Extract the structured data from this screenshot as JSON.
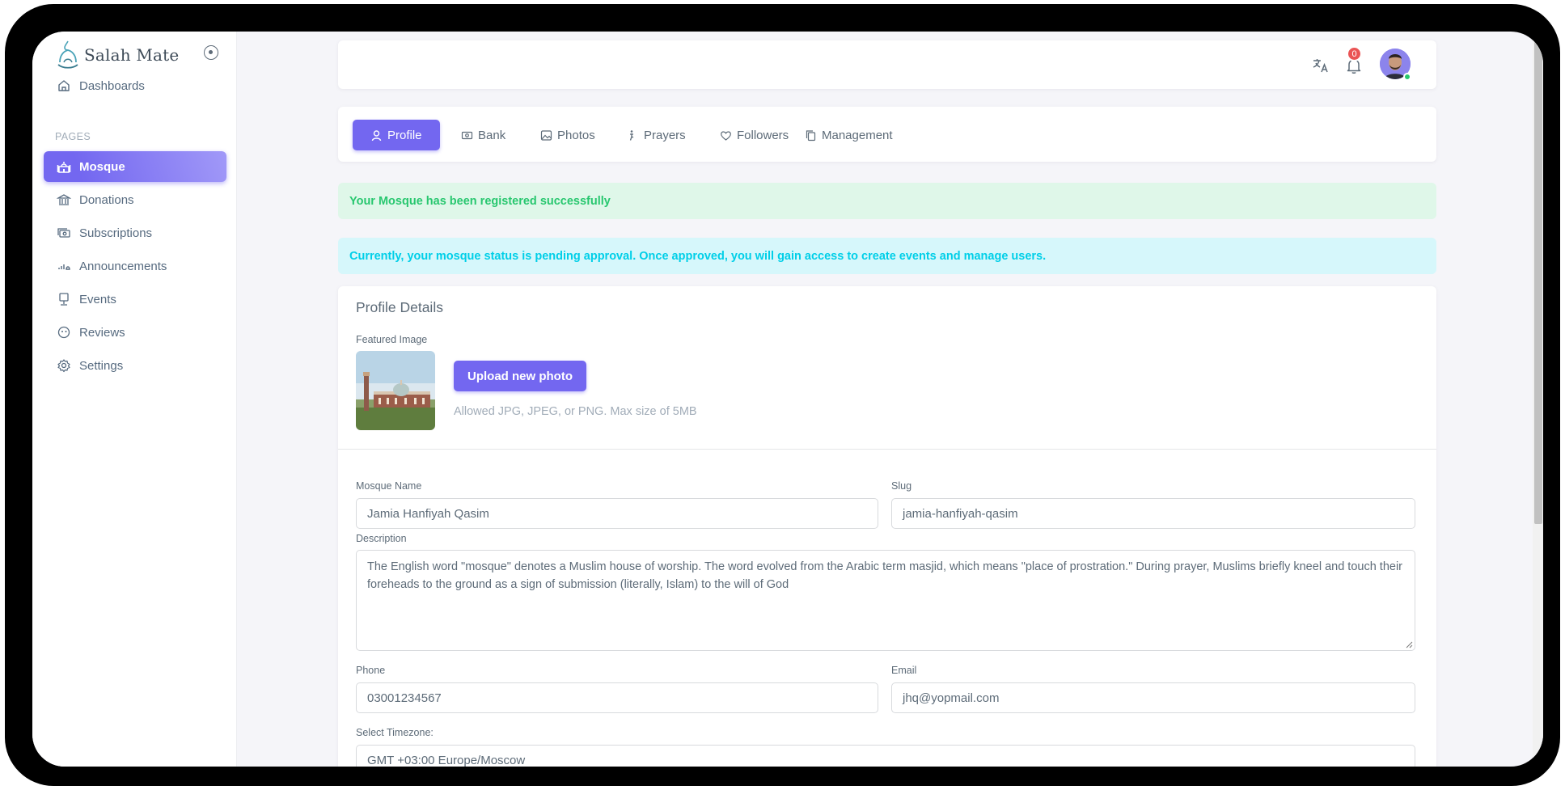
{
  "brand": {
    "name": "Salah Mate"
  },
  "sidebar": {
    "dashboards": "Dashboards",
    "section_label": "PAGES",
    "items": [
      {
        "label": "Mosque",
        "icon": "mosque-icon",
        "active": true
      },
      {
        "label": "Donations",
        "icon": "bank-icon"
      },
      {
        "label": "Subscriptions",
        "icon": "cash-icon"
      },
      {
        "label": "Announcements",
        "icon": "chart-icon"
      },
      {
        "label": "Events",
        "icon": "podium-icon"
      },
      {
        "label": "Reviews",
        "icon": "rating-icon"
      },
      {
        "label": "Settings",
        "icon": "gear-icon"
      }
    ]
  },
  "navbar": {
    "notification_count": "0"
  },
  "tabs": [
    {
      "label": "Profile",
      "active": true
    },
    {
      "label": "Bank"
    },
    {
      "label": "Photos"
    },
    {
      "label": "Prayers"
    },
    {
      "label": "Followers"
    },
    {
      "label": "Management"
    }
  ],
  "alerts": {
    "success": "Your Mosque has been registered successfully",
    "info": "Currently, your mosque status is pending approval. Once approved, you will gain access to create events and manage users."
  },
  "profile": {
    "title": "Profile Details",
    "featured_label": "Featured Image",
    "upload_button": "Upload new photo",
    "upload_hint": "Allowed JPG, JPEG, or PNG. Max size of 5MB",
    "mosque_name_label": "Mosque Name",
    "mosque_name": "Jamia Hanfiyah Qasim",
    "slug_label": "Slug",
    "slug": "jamia-hanfiyah-qasim",
    "description_label": "Description",
    "description": "The English word \"mosque\" denotes a Muslim house of worship. The word evolved from the Arabic term masjid, which means \"place of prostration.\" During prayer, Muslims briefly kneel and touch their foreheads to the ground as a sign of submission (literally, Islam) to the will of God",
    "phone_label": "Phone",
    "phone": "03001234567",
    "email_label": "Email",
    "email": "jhq@yopmail.com",
    "timezone_label": "Select Timezone:",
    "timezone": "GMT +03:00 Europe/Moscow"
  },
  "colors": {
    "primary": "#7367f0",
    "success": "#28c76f",
    "info": "#00cfe8",
    "danger": "#ea5455"
  }
}
